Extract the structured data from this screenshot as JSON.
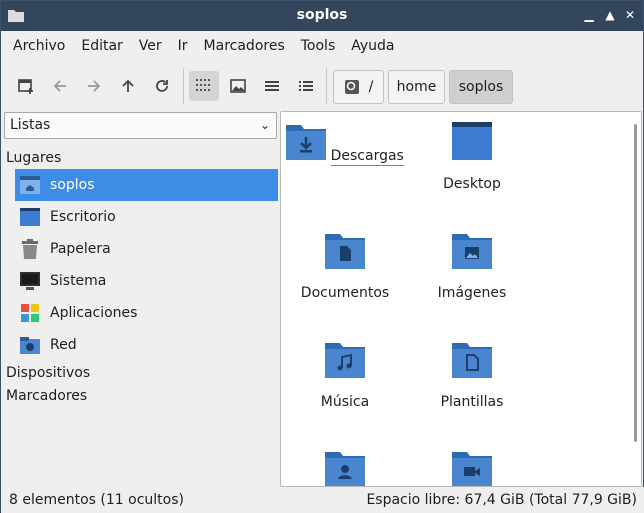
{
  "window": {
    "title": "soplos"
  },
  "menu": [
    "Archivo",
    "Editar",
    "Ver",
    "Ir",
    "Marcadores",
    "Tools",
    "Ayuda"
  ],
  "toolbar": {
    "buttons": [
      "new-tab-icon",
      "back-icon",
      "forward-icon",
      "up-icon",
      "reload-icon",
      "icon-view-icon",
      "thumbnail-view-icon",
      "compact-view-icon",
      "list-view-icon"
    ],
    "active_view": "icon-view",
    "path": [
      "/",
      "home",
      "soplos"
    ]
  },
  "sidebar": {
    "select_value": "Listas",
    "places_heading": "Lugares",
    "places": [
      {
        "label": "soplos",
        "icon": "home-folder-icon",
        "selected": true
      },
      {
        "label": "Escritorio",
        "icon": "desktop-icon"
      },
      {
        "label": "Papelera",
        "icon": "trash-icon"
      },
      {
        "label": "Sistema",
        "icon": "computer-icon"
      },
      {
        "label": "Aplicaciones",
        "icon": "applications-icon"
      },
      {
        "label": "Red",
        "icon": "network-icon"
      }
    ],
    "devices_heading": "Dispositivos",
    "bookmarks_heading": "Marcadores"
  },
  "files": [
    {
      "name": "Descargas",
      "icon": "downloads-folder-icon"
    },
    {
      "name": "Desktop",
      "icon": "desktop-folder-icon"
    },
    {
      "name": "Documentos",
      "icon": "documents-folder-icon"
    },
    {
      "name": "Imágenes",
      "icon": "pictures-folder-icon"
    },
    {
      "name": "Música",
      "icon": "music-folder-icon"
    },
    {
      "name": "Plantillas",
      "icon": "templates-folder-icon"
    },
    {
      "name": "",
      "icon": "public-folder-icon"
    },
    {
      "name": "",
      "icon": "videos-folder-icon"
    }
  ],
  "status": {
    "left": "8 elementos (11 ocultos)",
    "right": "Espacio libre: 67,4 GiB (Total 77,9 GiB)"
  },
  "colors": {
    "titlebar": "#34465c",
    "accent": "#3d8de6",
    "folder": "#4a86cf"
  }
}
